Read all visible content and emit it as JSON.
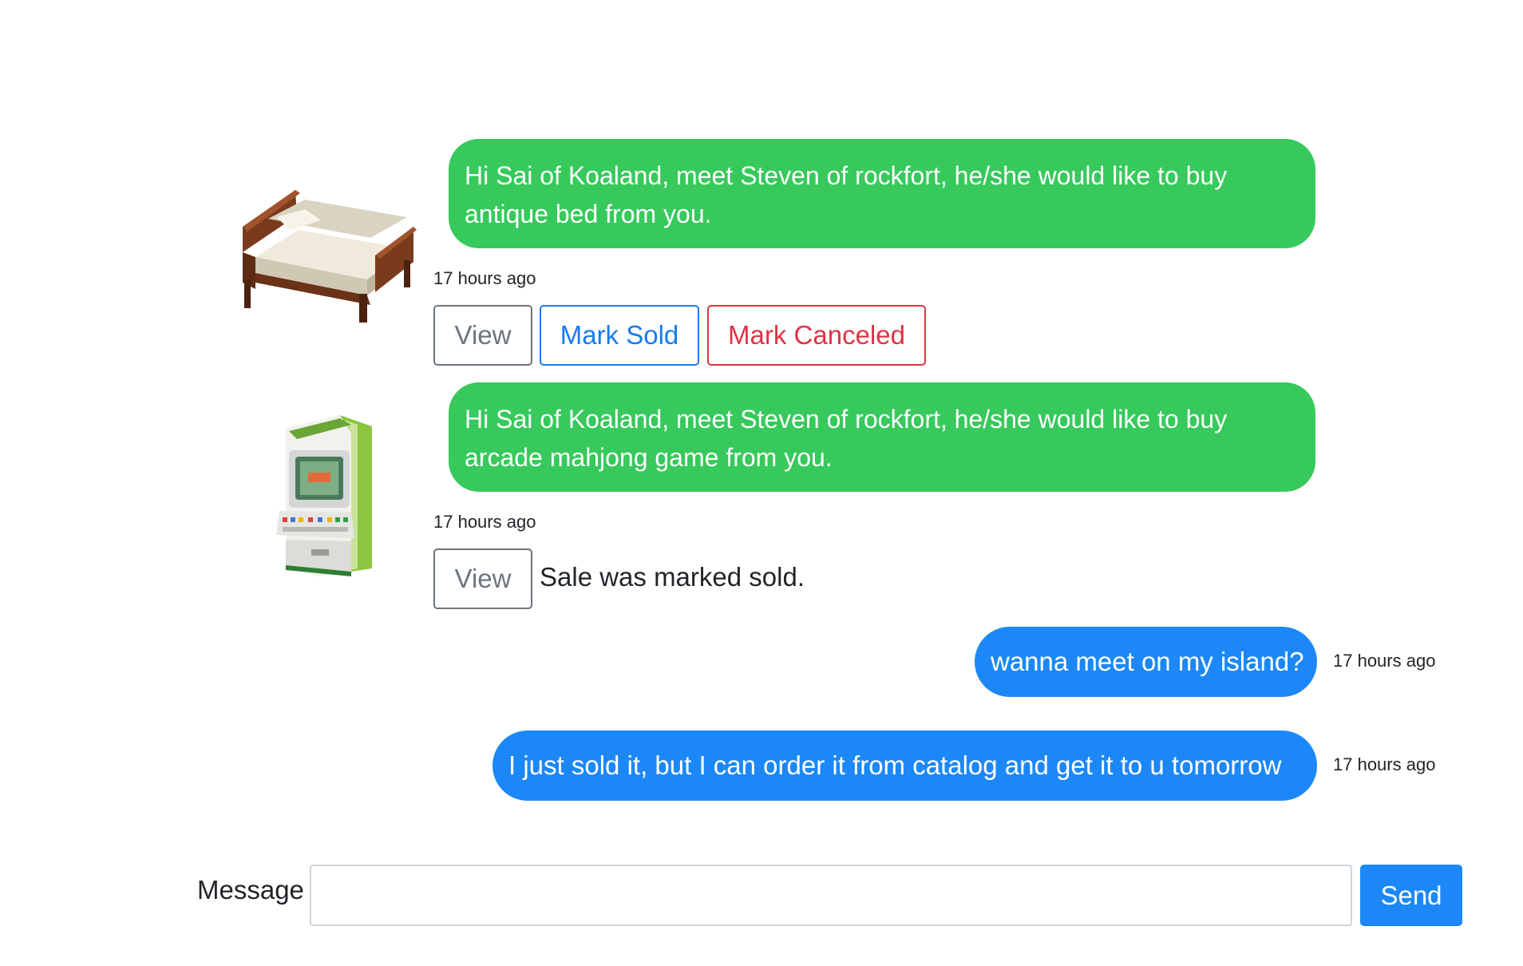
{
  "messages": [
    {
      "text": "Hi Sai of Koaland, meet Steven of rockfort, he/she would like to buy antique bed from you.",
      "timestamp": "17 hours ago",
      "item_icon": "antique-bed-icon",
      "actions": {
        "view": "View",
        "mark_sold": "Mark Sold",
        "mark_canceled": "Mark Canceled"
      }
    },
    {
      "text": "Hi Sai of Koaland, meet Steven of rockfort, he/she would like to buy arcade mahjong game from you.",
      "timestamp": "17 hours ago",
      "item_icon": "arcade-mahjong-game-icon",
      "actions": {
        "view": "View"
      },
      "status": "Sale was marked sold."
    },
    {
      "text": "wanna meet on my island?",
      "timestamp": "17 hours ago"
    },
    {
      "text": "I just sold it, but I can order it from catalog and get it to u tomorrow",
      "timestamp": "17 hours ago"
    }
  ],
  "composer": {
    "label": "Message",
    "value": "",
    "placeholder": "",
    "send_label": "Send"
  },
  "colors": {
    "system_bubble": "#37c95c",
    "user_bubble": "#1c88f7",
    "cancel": "#dc3545",
    "secondary": "#6c757d"
  }
}
